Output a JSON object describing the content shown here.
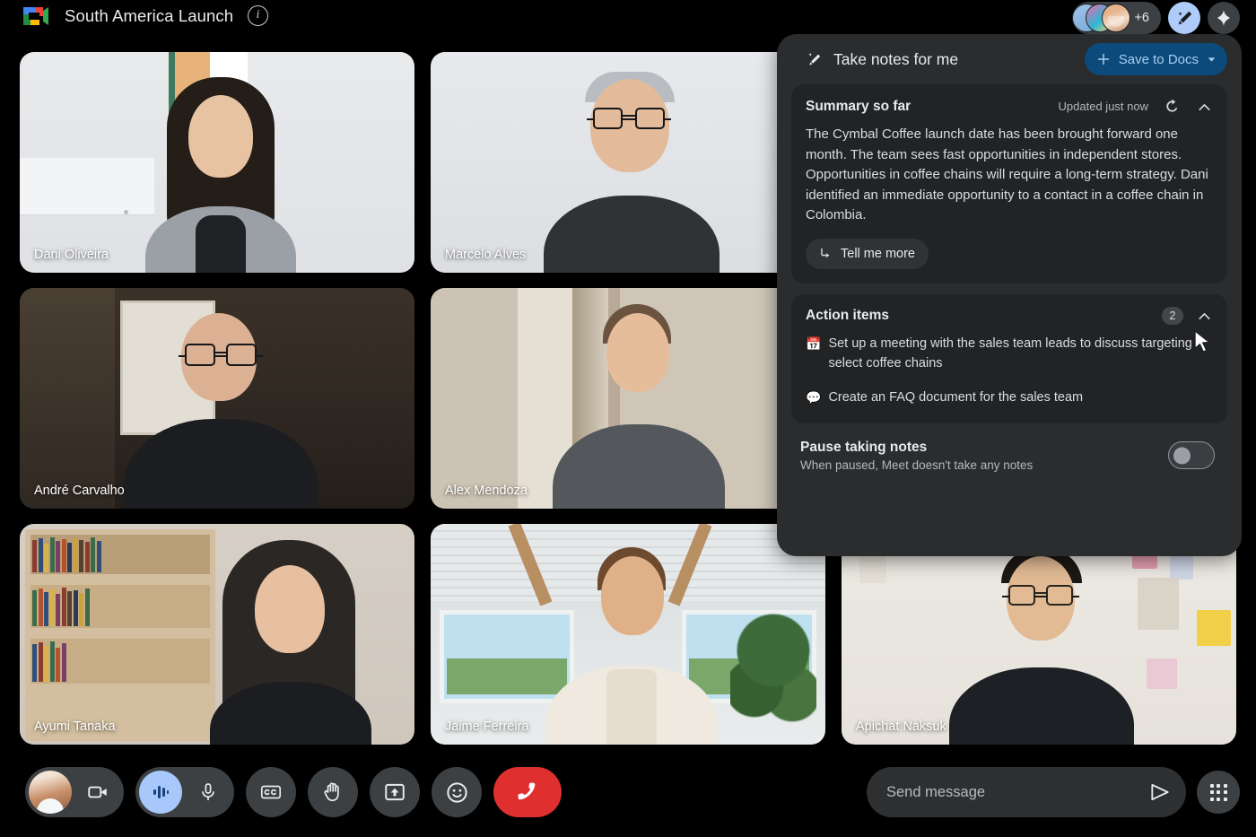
{
  "topbar": {
    "logo_icon": "google-meet-logo",
    "title": "South America Launch",
    "info_icon": "info-icon",
    "participants_overflow": "+6",
    "notes_icon": "take-notes-pencil-icon",
    "gemini_icon": "gemini-sparkle-icon"
  },
  "participants": [
    {
      "name": "Dani Oliveira"
    },
    {
      "name": "Marcelo Alves"
    },
    {
      "name": "André Carvalho"
    },
    {
      "name": "Alex Mendoza"
    },
    {
      "name": "Ayumi Tanaka"
    },
    {
      "name": "Jaime Ferreira"
    },
    {
      "name": "Apichat Naksuk"
    }
  ],
  "notes_panel": {
    "header_icon": "magic-pencil-icon",
    "header_title": "Take notes for me",
    "save_button": {
      "plus_icon": "plus-icon",
      "label": "Save to Docs",
      "dropdown_icon": "chevron-down-icon"
    },
    "summary": {
      "title": "Summary so far",
      "updated": "Updated just now",
      "refresh_icon": "refresh-icon",
      "collapse_icon": "chevron-up-icon",
      "text": "The Cymbal Coffee launch date has been brought forward one month. The team sees fast opportunities in independent stores. Opportunities in coffee chains will require a long-term strategy. Dani identified an immediate opportunity to a contact in a coffee chain in Colombia.",
      "tell_me_more": {
        "icon": "arrow-turn-down-right-icon",
        "label": "Tell me more"
      }
    },
    "action_items": {
      "title": "Action items",
      "count": "2",
      "collapse_icon": "chevron-up-icon",
      "items": [
        {
          "icon": "calendar-emoji",
          "glyph": "📅",
          "text": "Set up a meeting with the sales team leads to discuss targeting select coffee chains"
        },
        {
          "icon": "speech-bubble-emoji",
          "glyph": "💬",
          "text": "Create an FAQ document for the sales team"
        }
      ]
    },
    "pause": {
      "title": "Pause taking notes",
      "subtitle": "When paused, Meet doesn't take any notes",
      "toggle_state": "off"
    }
  },
  "bottombar": {
    "controls": [
      {
        "name": "camera-toggle",
        "icon": "video-camera-icon"
      },
      {
        "name": "microphone-toggle",
        "icon": "microphone-icon"
      },
      {
        "name": "captions-toggle",
        "icon": "closed-captions-icon"
      },
      {
        "name": "raise-hand",
        "icon": "raised-hand-icon"
      },
      {
        "name": "present-screen",
        "icon": "present-screen-icon"
      },
      {
        "name": "reactions",
        "icon": "smiley-face-icon"
      },
      {
        "name": "leave-call",
        "icon": "phone-hangup-icon"
      }
    ],
    "message": {
      "placeholder": "Send message",
      "value": "",
      "send_icon": "send-paper-plane-icon"
    },
    "apps_icon": "apps-grid-icon"
  },
  "colors": {
    "accent_blue": "#a8c7fa",
    "save_button_bg": "#0b4a7a",
    "save_button_text": "#a8cdf0",
    "leave_red": "#e02f2f",
    "panel_bg": "#2a2c2e",
    "card_bg": "#212325"
  }
}
